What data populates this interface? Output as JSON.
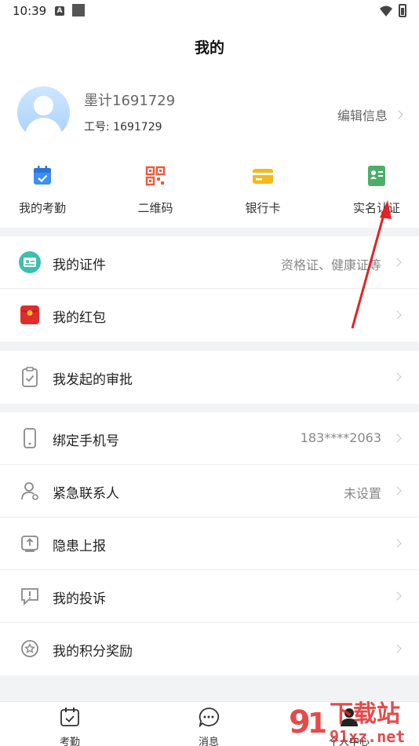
{
  "status_bar": {
    "time": "10:39"
  },
  "header": {
    "title": "我的"
  },
  "profile": {
    "name": "墨计1691729",
    "employee_id": "工号: 1691729",
    "edit_label": "编辑信息"
  },
  "quick_actions": [
    {
      "label": "我的考勤",
      "icon": "calendar-check-icon",
      "color": "#3d8ef5"
    },
    {
      "label": "二维码",
      "icon": "qr-code-icon",
      "color": "#f05a3a"
    },
    {
      "label": "银行卡",
      "icon": "bank-card-icon",
      "color": "#f5b91b"
    },
    {
      "label": "实名认证",
      "icon": "id-card-icon",
      "color": "#4cae6a"
    }
  ],
  "menu": {
    "group1": [
      {
        "label": "我的证件",
        "value": "资格证、健康证等",
        "icon": "certificate-icon"
      },
      {
        "label": "我的红包",
        "value": "",
        "icon": "red-envelope-icon"
      }
    ],
    "group2": [
      {
        "label": "我发起的审批",
        "value": "",
        "icon": "clipboard-check-icon"
      }
    ],
    "group3": [
      {
        "label": "绑定手机号",
        "value": "183****2063",
        "icon": "phone-icon"
      },
      {
        "label": "紧急联系人",
        "value": "未设置",
        "icon": "contact-icon"
      },
      {
        "label": "隐患上报",
        "value": "",
        "icon": "upload-report-icon"
      },
      {
        "label": "我的投诉",
        "value": "",
        "icon": "complaint-icon"
      },
      {
        "label": "我的积分奖励",
        "value": "",
        "icon": "points-star-icon"
      }
    ]
  },
  "tabbar": [
    {
      "label": "考勤",
      "icon": "calendar-check-icon"
    },
    {
      "label": "消息",
      "icon": "chat-bubble-icon"
    },
    {
      "label": "个人中心",
      "icon": "person-icon"
    }
  ],
  "watermark": {
    "text": "下载站",
    "site": "91xz.net"
  },
  "colors": {
    "accent_red": "#e02c2c",
    "blue": "#3d8ef5"
  }
}
